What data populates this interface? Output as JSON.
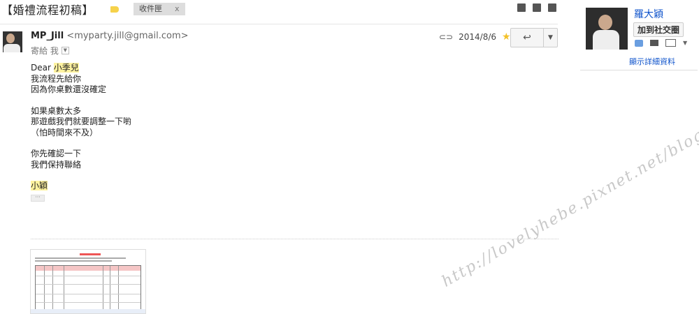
{
  "thread": {
    "subject": "【婚禮流程初稿】",
    "inbox_label": "收件匣",
    "inbox_remove": "x"
  },
  "message": {
    "sender_name": "MP_Jill",
    "sender_email": "<myparty.jill@gmail.com>",
    "to_line": "寄給 我",
    "date": "2014/8/6",
    "greeting_prefix": "Dear ",
    "greeting_name": "小季兒",
    "paragraphs": [
      [
        "我流程先給你",
        "因為你桌數還沒確定"
      ],
      [
        "如果桌數太多",
        "那遊戲我們就要調整一下喲",
        "（怕時間來不及）"
      ],
      [
        "你先確認一下",
        "我們保持聯絡"
      ]
    ],
    "signature": "小穎",
    "ellipsis": "···"
  },
  "contact": {
    "name": "羅大穎",
    "add_button": "加到社交圈",
    "details_link": "顯示詳細資料"
  },
  "watermark": {
    "text": "http://lovelyhebe.pixnet.net/blog"
  },
  "colors": {
    "link": "#1155cc",
    "label_tag": "#f6d24b",
    "star": "#f3c128",
    "highlight": "#fff3a0"
  }
}
